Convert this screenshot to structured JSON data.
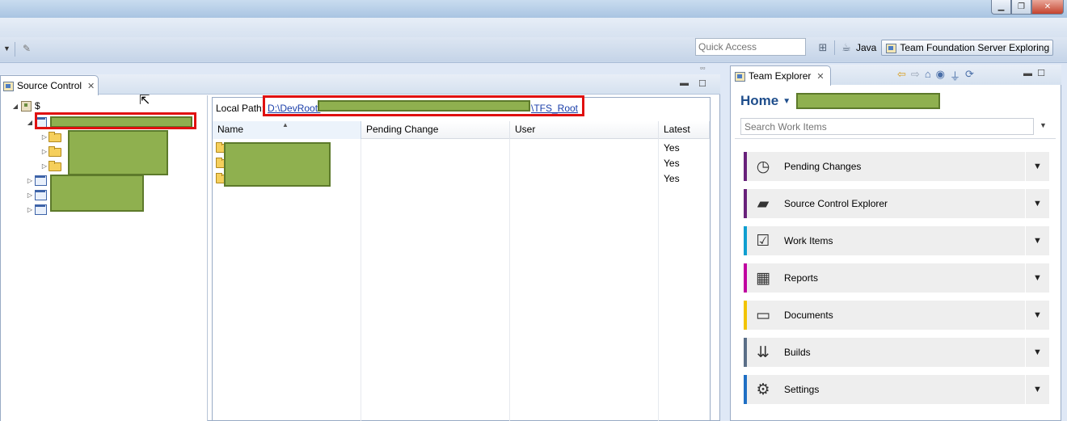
{
  "window": {
    "minimize_icon": "minimize-icon",
    "restore_icon": "restore-icon",
    "close_icon": "close-icon"
  },
  "toolbar": {
    "quick_access_placeholder": "Quick Access",
    "java_label": "Java",
    "tfs_label": "Team Foundation Server Exploring"
  },
  "source_control": {
    "tab_label": "Source Control",
    "root_label": "$",
    "local_path_label": "Local Path:",
    "local_path_prefix": "D:\\DevRoot\\",
    "local_path_suffix": "\\TFS_Root",
    "columns": [
      "Name",
      "Pending Change",
      "User",
      "Latest"
    ],
    "rows": [
      {
        "latest": "Yes"
      },
      {
        "latest": "Yes"
      },
      {
        "latest": "Yes"
      }
    ]
  },
  "team_explorer": {
    "tab_label": "Team Explorer",
    "home_label": "Home",
    "search_placeholder": "Search Work Items",
    "items": [
      {
        "label": "Pending Changes",
        "color": "#68217a",
        "icon": "clock-icon"
      },
      {
        "label": "Source Control Explorer",
        "color": "#68217a",
        "icon": "source-control-icon"
      },
      {
        "label": "Work Items",
        "color": "#0e9ed0",
        "icon": "work-items-icon"
      },
      {
        "label": "Reports",
        "color": "#c000a0",
        "icon": "reports-icon"
      },
      {
        "label": "Documents",
        "color": "#f2c400",
        "icon": "documents-icon"
      },
      {
        "label": "Builds",
        "color": "#5a6e87",
        "icon": "builds-icon"
      },
      {
        "label": "Settings",
        "color": "#1f6fc4",
        "icon": "settings-icon"
      }
    ]
  }
}
